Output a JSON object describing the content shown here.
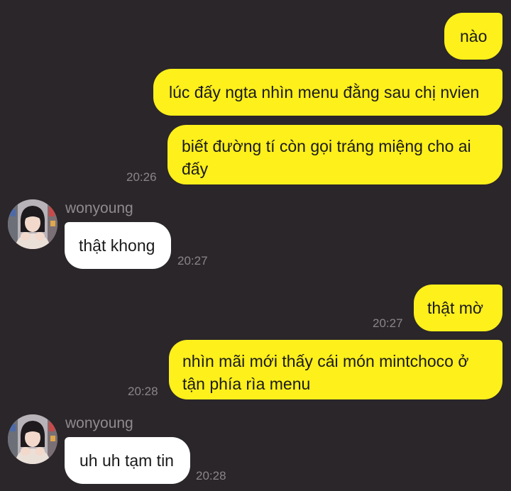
{
  "chat": {
    "contact_name": "wonyoung",
    "messages": [
      {
        "text": "nào",
        "time": ""
      },
      {
        "text": "lúc đấy ngta nhìn menu đằng sau chị nvien",
        "time": ""
      },
      {
        "line1": "biết đường tí còn gọi tráng miệng cho ai",
        "line2": "đấy",
        "time": "20:26"
      },
      {
        "text": "thật khong",
        "time": "20:27"
      },
      {
        "text": "thật mờ",
        "time": "20:27"
      },
      {
        "line1": "nhìn mãi mới thấy cái món mintchoco ở",
        "line2": "tận phía rìa menu",
        "time": "20:28"
      },
      {
        "text": "uh uh tạm tin",
        "time": "20:28"
      }
    ]
  },
  "colors": {
    "background": "#2a2629",
    "outgoing_bubble": "#fef01b",
    "incoming_bubble": "#ffffff",
    "timestamp": "#8a8589"
  },
  "icons": {
    "avatar": "avatar-photo-icon"
  }
}
